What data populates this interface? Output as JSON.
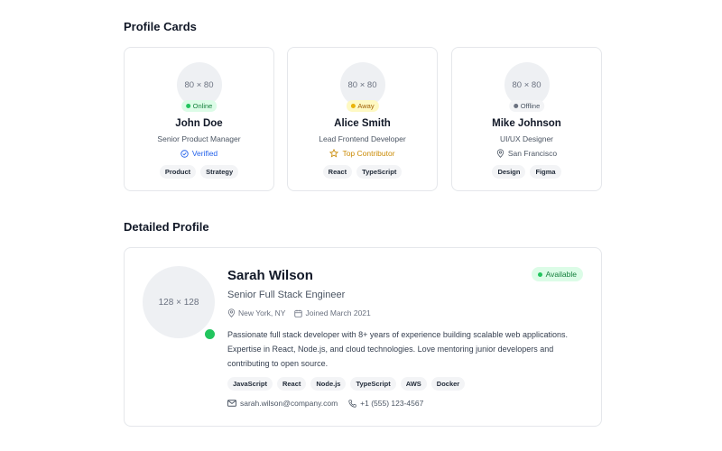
{
  "sections": {
    "profile_cards_title": "Profile Cards",
    "detailed_profile_title": "Detailed Profile"
  },
  "cards": [
    {
      "avatar_placeholder": "80 × 80",
      "status": "Online",
      "name": "John Doe",
      "role": "Senior Product Manager",
      "meta": "Verified",
      "meta_icon": "check-circle-icon",
      "tags": [
        "Product",
        "Strategy"
      ]
    },
    {
      "avatar_placeholder": "80 × 80",
      "status": "Away",
      "name": "Alice Smith",
      "role": "Lead Frontend Developer",
      "meta": "Top Contributor",
      "meta_icon": "star-icon",
      "tags": [
        "React",
        "TypeScript"
      ]
    },
    {
      "avatar_placeholder": "80 × 80",
      "status": "Offline",
      "name": "Mike Johnson",
      "role": "UI/UX Designer",
      "meta": "San Francisco",
      "meta_icon": "map-pin-icon",
      "tags": [
        "Design",
        "Figma"
      ]
    }
  ],
  "detail": {
    "avatar_placeholder": "128 × 128",
    "name": "Sarah Wilson",
    "role": "Senior Full Stack Engineer",
    "location": "New York, NY",
    "joined": "Joined March 2021",
    "availability": "Available",
    "bio": "Passionate full stack developer with 8+ years of experience building scalable web applications. Expertise in React, Node.js, and cloud technologies. Love mentoring junior developers and contributing to open source.",
    "tags": [
      "JavaScript",
      "React",
      "Node.js",
      "TypeScript",
      "AWS",
      "Docker"
    ],
    "email": "sarah.wilson@company.com",
    "phone": "+1 (555) 123-4567"
  },
  "colors": {
    "online": "#22c55e",
    "away": "#eab308",
    "offline": "#6b7280",
    "verified": "#2563eb",
    "top_contributor": "#ca8a04"
  }
}
